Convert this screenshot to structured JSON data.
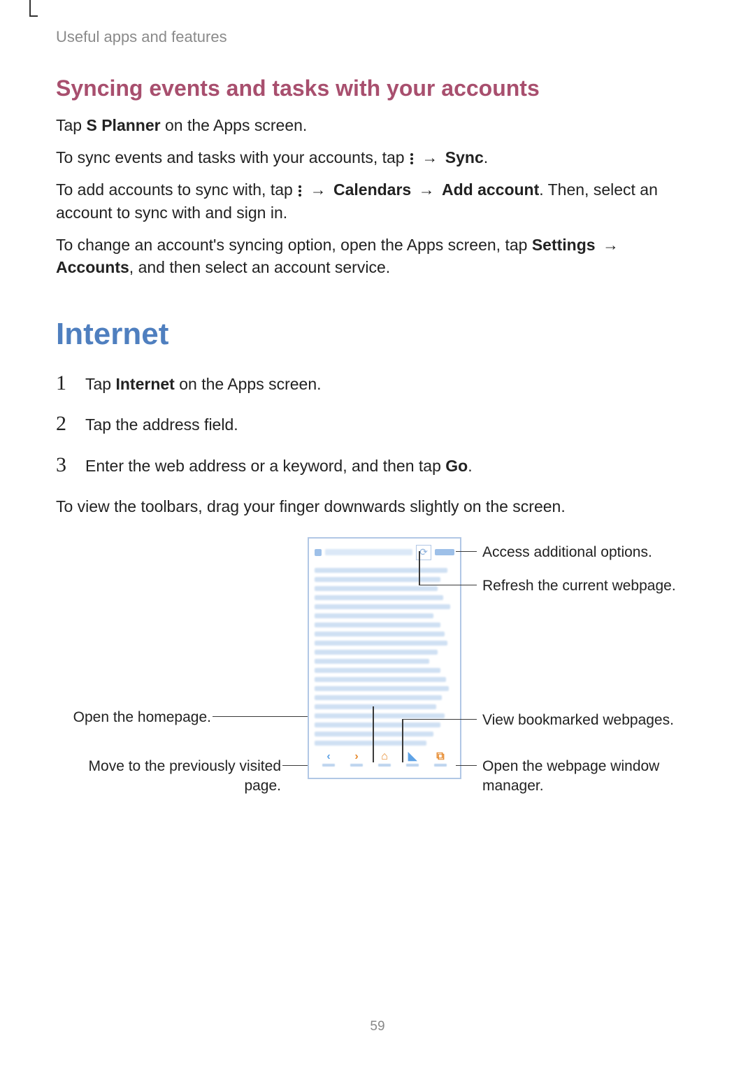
{
  "header": "Useful apps and features",
  "section_title": "Syncing events and tasks with your accounts",
  "p1_pre": "Tap ",
  "p1_bold": "S Planner",
  "p1_post": " on the Apps screen.",
  "p2_pre": "To sync events and tasks with your accounts, tap ",
  "arrow": "→",
  "p2_sync": "Sync",
  "p2_post": ".",
  "p3_pre": "To add accounts to sync with, tap ",
  "p3_calendars": "Calendars",
  "p3_add": "Add account",
  "p3_post": ". Then, select an account to sync with and sign in.",
  "p4_pre": "To change an account's syncing option, open the Apps screen, tap ",
  "p4_settings": "Settings",
  "p4_accounts": "Accounts",
  "p4_post": ", and then select an account service.",
  "title_internet": "Internet",
  "steps": {
    "s1_pre": "Tap ",
    "s1_bold": "Internet",
    "s1_post": " on the Apps screen.",
    "s2": "Tap the address field.",
    "s3_pre": "Enter the web address or a keyword, and then tap ",
    "s3_bold": "Go",
    "s3_post": "."
  },
  "after_steps": "To view the toolbars, drag your finger downwards slightly on the screen.",
  "callouts": {
    "access_options": "Access additional options.",
    "refresh": "Refresh the current webpage.",
    "homepage": "Open the homepage.",
    "bookmarks": "View bookmarked webpages.",
    "back_page": "Move to the previously visited page.",
    "window_mgr": "Open the webpage window manager."
  },
  "nav_glyphs": {
    "back": "‹",
    "forward": "›",
    "home": "⌂",
    "bookmark": "◣",
    "windows": "⧉"
  },
  "refresh_glyph": "⟳",
  "page_number": "59"
}
